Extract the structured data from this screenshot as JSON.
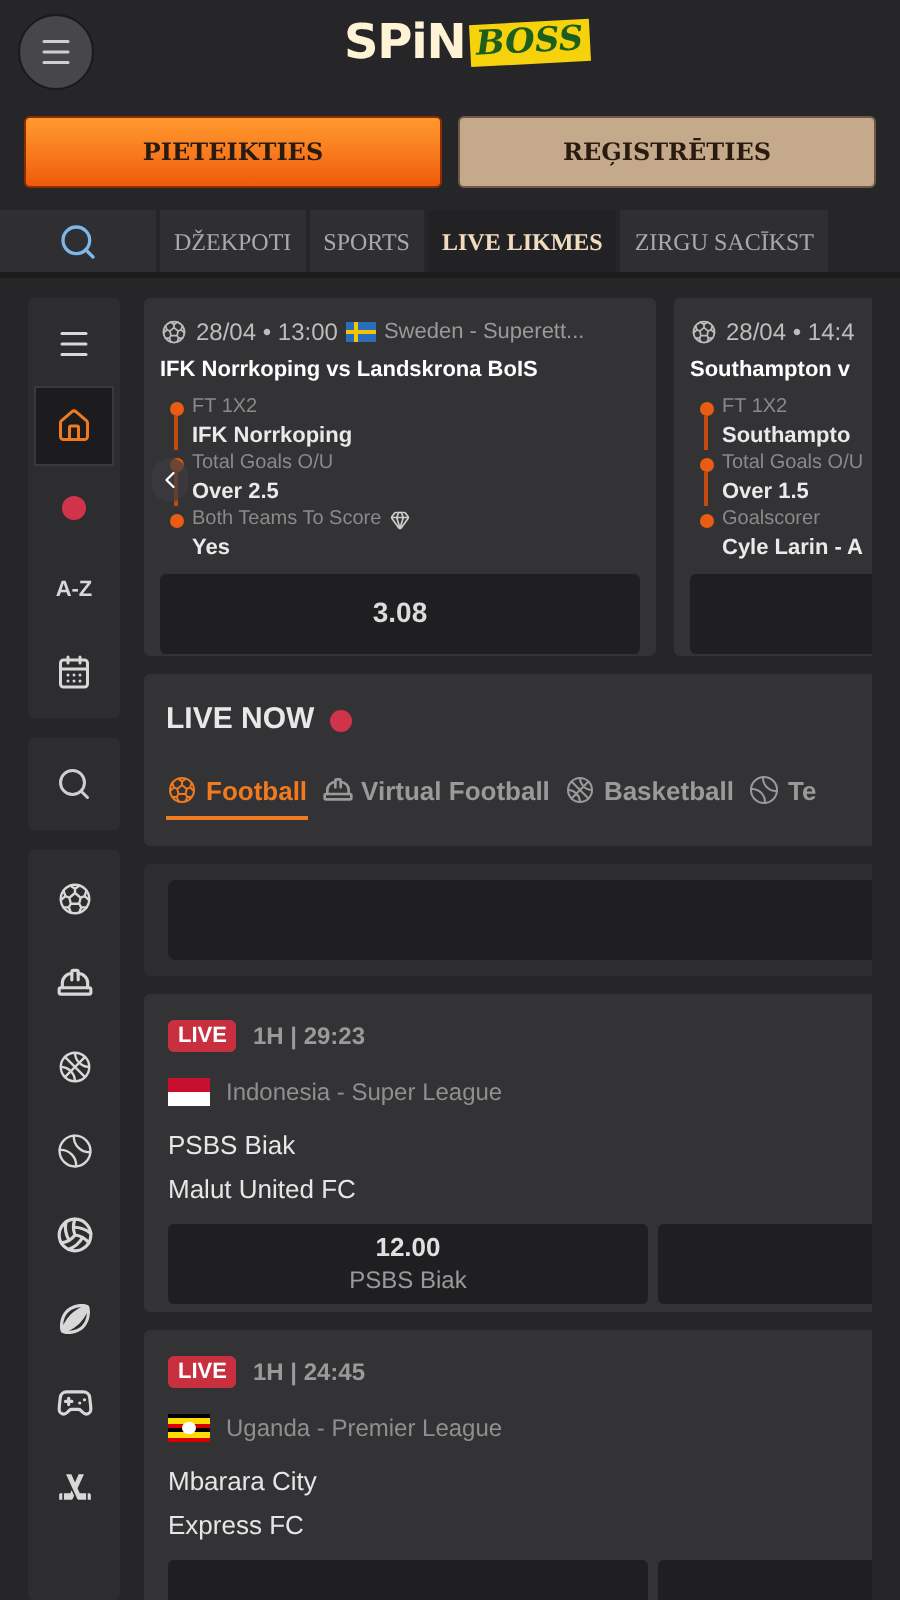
{
  "header": {
    "logo": {
      "first": "SPiN",
      "second": "BOSS"
    }
  },
  "auth_buttons": [
    {
      "label": "PIETEIKTIES",
      "kind": "login"
    },
    {
      "label": "REĢISTRĒTIES",
      "kind": "register"
    }
  ],
  "nav_tabs": [
    {
      "label": "DŽEKPOTI",
      "selected": false
    },
    {
      "label": "SPORTS",
      "selected": false
    },
    {
      "label": "LIVE LIKMES",
      "selected": true
    },
    {
      "label": "ZIRGU SACĪKST",
      "selected": false
    }
  ],
  "sidebar": {
    "top_items": [
      {
        "kind": "menu",
        "selected": false
      },
      {
        "kind": "home",
        "selected": true
      },
      {
        "kind": "live",
        "selected": false
      },
      {
        "kind": "az",
        "label": "A-Z",
        "selected": false
      },
      {
        "kind": "scoreboard",
        "selected": false
      }
    ],
    "sports": [
      {
        "kind": "football"
      },
      {
        "kind": "helmet"
      },
      {
        "kind": "basketball"
      },
      {
        "kind": "tennis"
      },
      {
        "kind": "volleyball"
      },
      {
        "kind": "rugby"
      },
      {
        "kind": "gamepad"
      },
      {
        "kind": "hockey"
      }
    ]
  },
  "featured_bets": [
    {
      "date": "28/04 • 13:00",
      "league": "Sweden - Superett...",
      "title": "IFK Norrkoping vs Landskrona BoIS",
      "odds": "3.08",
      "legs": [
        {
          "market": "FT 1X2",
          "pick": "IFK Norrkoping"
        },
        {
          "market": "Total Goals O/U",
          "pick": "Over 2.5"
        },
        {
          "market": "Both Teams To Score",
          "pick": "Yes",
          "boosted": true
        }
      ]
    },
    {
      "date": "28/04 • 14:4",
      "title": "Southampton v",
      "legs": [
        {
          "market": "FT 1X2",
          "pick": "Southampto"
        },
        {
          "market": "Total Goals O/U",
          "pick": "Over 1.5"
        },
        {
          "market": "Goalscorer",
          "pick": "Cyle Larin - A"
        }
      ]
    }
  ],
  "live_now": {
    "title": "LIVE NOW",
    "sport_tabs": [
      {
        "label": "Football",
        "kind": "football",
        "selected": true
      },
      {
        "label": "Virtual Football",
        "kind": "helmet",
        "selected": false
      },
      {
        "label": "Basketball",
        "kind": "basketball",
        "selected": false
      },
      {
        "label": "Te",
        "kind": "tennis",
        "selected": false
      }
    ]
  },
  "matches": [
    {
      "status": "LIVE",
      "time": "1H | 29:23",
      "league": "Indonesia - Super League",
      "home": "PSBS Biak",
      "away": "Malut United FC",
      "odds": [
        {
          "value": "12.00",
          "label": "PSBS Biak"
        }
      ]
    },
    {
      "status": "LIVE",
      "time": "1H | 24:45",
      "league": "Uganda - Premier League",
      "home": "Mbarara City",
      "away": "Express FC"
    }
  ]
}
